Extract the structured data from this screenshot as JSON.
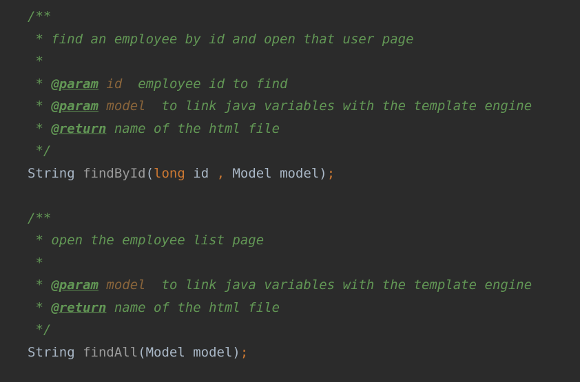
{
  "lines": [
    {
      "parts": [
        {
          "cls": "doc",
          "t": "/**"
        }
      ]
    },
    {
      "parts": [
        {
          "cls": "doc",
          "t": " * find an employee by id and open that user page"
        }
      ]
    },
    {
      "parts": [
        {
          "cls": "doc",
          "t": " *"
        }
      ]
    },
    {
      "parts": [
        {
          "cls": "doc",
          "t": " * "
        },
        {
          "cls": "tag",
          "t": "@param"
        },
        {
          "cls": "doc",
          "t": " "
        },
        {
          "cls": "pname",
          "t": "id"
        },
        {
          "cls": "doc",
          "t": "  employee id to find"
        }
      ]
    },
    {
      "parts": [
        {
          "cls": "doc",
          "t": " * "
        },
        {
          "cls": "tag",
          "t": "@param"
        },
        {
          "cls": "doc",
          "t": " "
        },
        {
          "cls": "pname",
          "t": "model"
        },
        {
          "cls": "doc",
          "t": "  to link java variables with the template engine"
        }
      ]
    },
    {
      "parts": [
        {
          "cls": "doc",
          "t": " * "
        },
        {
          "cls": "tag",
          "t": "@return"
        },
        {
          "cls": "doc",
          "t": " name of the html file"
        }
      ]
    },
    {
      "parts": [
        {
          "cls": "doc",
          "t": " */"
        }
      ]
    },
    {
      "parts": [
        {
          "cls": "type",
          "t": "String "
        },
        {
          "cls": "method",
          "t": "findById"
        },
        {
          "cls": "plain",
          "t": "("
        },
        {
          "cls": "kw",
          "t": "long"
        },
        {
          "cls": "plain",
          "t": " id "
        },
        {
          "cls": "punct",
          "t": ","
        },
        {
          "cls": "plain",
          "t": " Model model)"
        },
        {
          "cls": "punct",
          "t": ";"
        }
      ]
    },
    {
      "parts": []
    },
    {
      "parts": [
        {
          "cls": "doc",
          "t": "/**"
        }
      ]
    },
    {
      "parts": [
        {
          "cls": "doc",
          "t": " * open the employee list page"
        }
      ]
    },
    {
      "parts": [
        {
          "cls": "doc",
          "t": " *"
        }
      ]
    },
    {
      "parts": [
        {
          "cls": "doc",
          "t": " * "
        },
        {
          "cls": "tag",
          "t": "@param"
        },
        {
          "cls": "doc",
          "t": " "
        },
        {
          "cls": "pname",
          "t": "model"
        },
        {
          "cls": "doc",
          "t": "  to link java variables with the template engine"
        }
      ]
    },
    {
      "parts": [
        {
          "cls": "doc",
          "t": " * "
        },
        {
          "cls": "tag",
          "t": "@return"
        },
        {
          "cls": "doc",
          "t": " name of the html file"
        }
      ]
    },
    {
      "parts": [
        {
          "cls": "doc",
          "t": " */"
        }
      ]
    },
    {
      "parts": [
        {
          "cls": "type",
          "t": "String "
        },
        {
          "cls": "method",
          "t": "findAll"
        },
        {
          "cls": "plain",
          "t": "(Model model)"
        },
        {
          "cls": "punct",
          "t": ";"
        }
      ]
    }
  ]
}
